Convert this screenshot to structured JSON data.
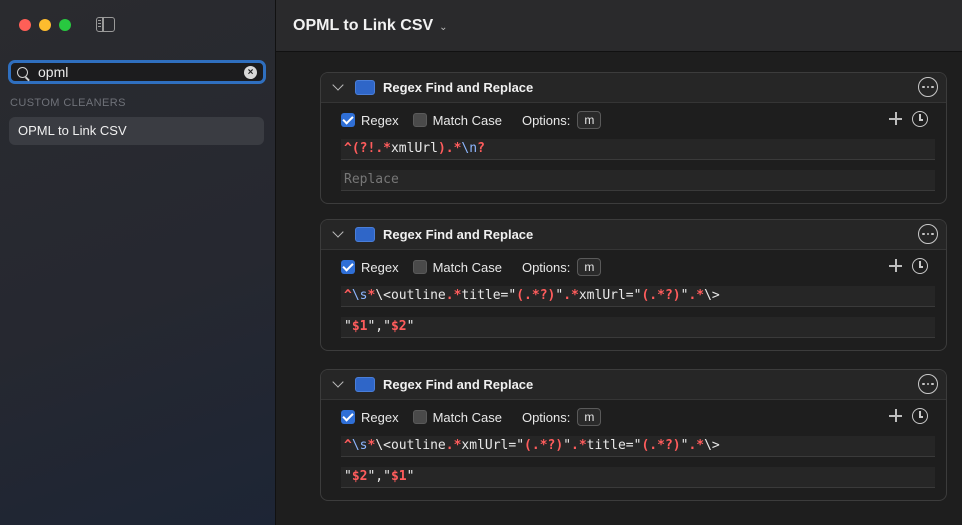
{
  "sidebar": {
    "search_value": "opml",
    "section_title": "CUSTOM CLEANERS",
    "item_label": "OPML to Link CSV"
  },
  "main": {
    "title": "OPML to Link CSV",
    "cards": [
      {
        "title": "Regex Find and Replace",
        "regex_label": "Regex",
        "regex_checked": true,
        "match_case_label": "Match Case",
        "match_case_checked": false,
        "options_label": "Options:",
        "options_value": "m",
        "find": "^(?!.*xmlUrl).*\\n?",
        "replace": "",
        "replace_placeholder": "Replace"
      },
      {
        "title": "Regex Find and Replace",
        "regex_label": "Regex",
        "regex_checked": true,
        "match_case_label": "Match Case",
        "match_case_checked": false,
        "options_label": "Options:",
        "options_value": "m",
        "find": "^\\s*\\<outline.*title=\"(.*?)\".*xmlUrl=\"(.*?)\".*\\>",
        "replace": "\"$1\",\"$2\""
      },
      {
        "title": "Regex Find and Replace",
        "regex_label": "Regex",
        "regex_checked": true,
        "match_case_label": "Match Case",
        "match_case_checked": false,
        "options_label": "Options:",
        "options_value": "m",
        "find": "^\\s*\\<outline.*xmlUrl=\"(.*?)\".*title=\"(.*?)\".*\\>",
        "replace": "\"$2\",\"$1\""
      }
    ]
  },
  "colors": {
    "accent": "#2f6fd6",
    "swatch": "#2f66c8",
    "regex_token": "#ff5c5c"
  }
}
